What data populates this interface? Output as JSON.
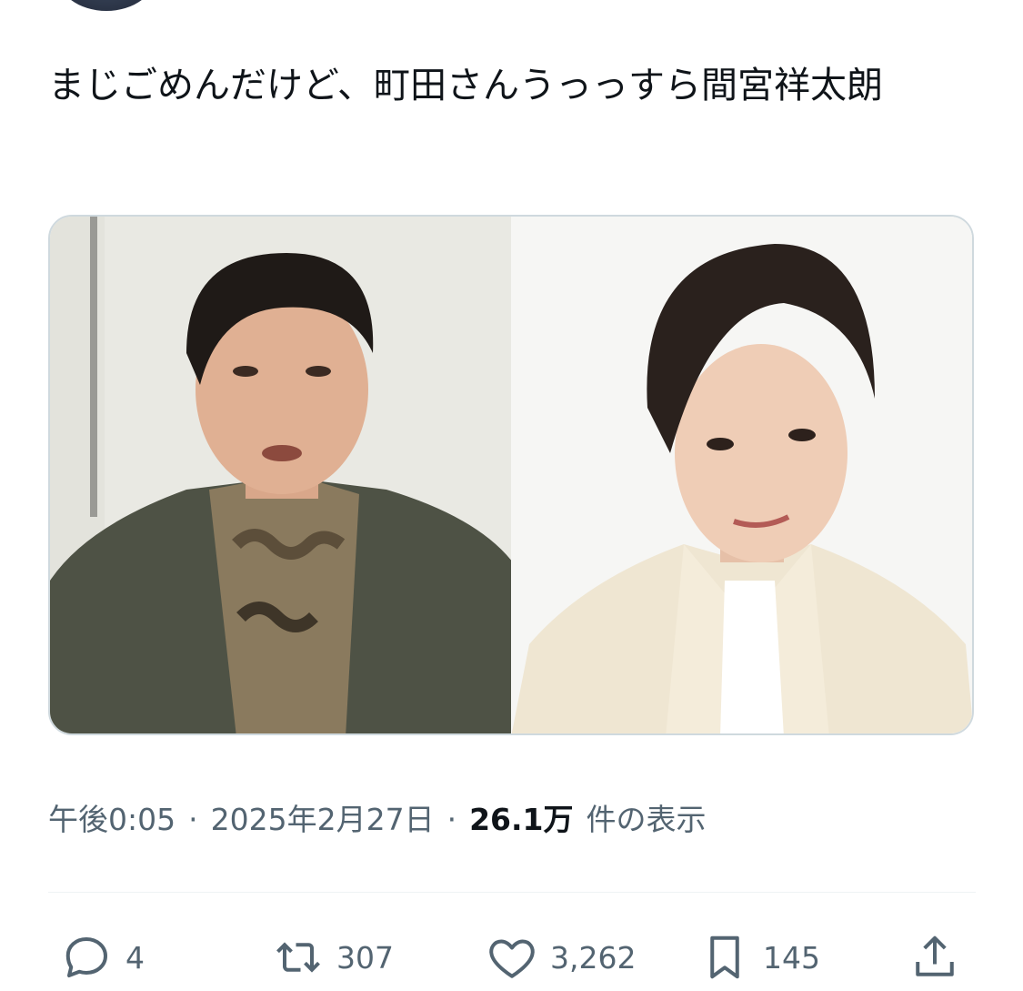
{
  "tweet": {
    "text": "まじごめんだけど、町田さんうっっすら間宮祥太朗"
  },
  "images": [
    {
      "icon": "photo-man-green-jacket"
    },
    {
      "icon": "photo-man-white-jacket"
    }
  ],
  "meta": {
    "time": "午後0:05",
    "date": "2025年2月27日",
    "views_number": "26.1万",
    "views_label": "件の表示",
    "separator": "·"
  },
  "actions": {
    "replies": "4",
    "retweets": "307",
    "likes": "3,262",
    "bookmarks": "145"
  },
  "colors": {
    "text": "#0f1419",
    "secondary": "#536471",
    "border": "#cfd9de"
  }
}
